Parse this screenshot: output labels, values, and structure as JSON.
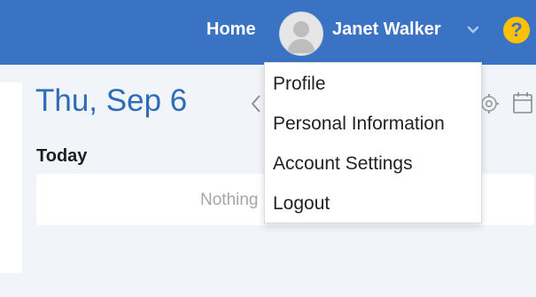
{
  "header": {
    "home_label": "Home",
    "user_name": "Janet Walker",
    "help_glyph": "?"
  },
  "main": {
    "date_title": "Thu, Sep 6",
    "section_heading": "Today",
    "empty_message": "Nothing"
  },
  "dropdown": {
    "items": [
      {
        "label": "Profile"
      },
      {
        "label": "Personal Information"
      },
      {
        "label": "Account Settings"
      },
      {
        "label": "Logout"
      }
    ]
  },
  "icons": {
    "avatar": "user-avatar-placeholder",
    "chevron": "chevron-down-icon",
    "help": "help-icon",
    "prev": "chevron-left-icon",
    "settings": "gear-icon",
    "calendar": "calendar-icon"
  },
  "colors": {
    "header_bg": "#3a73c4",
    "accent_title": "#2f6cb8",
    "help_badge": "#ffc107",
    "page_bg": "#f1f4f8"
  }
}
